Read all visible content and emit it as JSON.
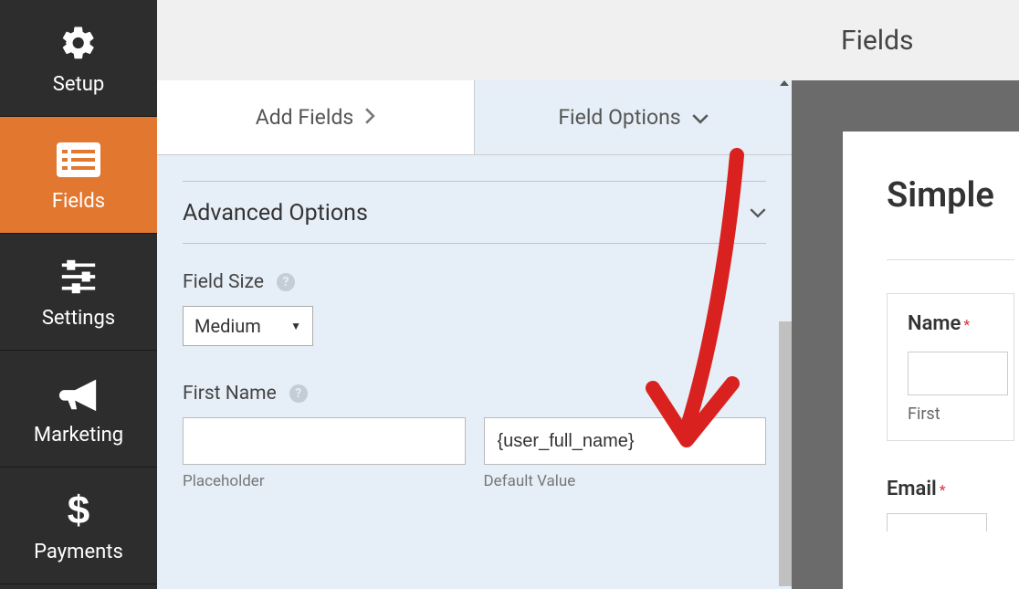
{
  "sidebar": {
    "items": [
      {
        "label": "Setup"
      },
      {
        "label": "Fields"
      },
      {
        "label": "Settings"
      },
      {
        "label": "Marketing"
      },
      {
        "label": "Payments"
      }
    ]
  },
  "tabs": {
    "add_fields": "Add Fields",
    "field_options": "Field Options"
  },
  "advanced": {
    "title": "Advanced Options",
    "field_size_label": "Field Size",
    "field_size_value": "Medium",
    "first_name_label": "First Name",
    "placeholder_label": "Placeholder",
    "default_value_label": "Default Value",
    "placeholder_value": "",
    "default_value": "{user_full_name}"
  },
  "right": {
    "header": "Fields",
    "form_title": "Simple",
    "name_label": "Name",
    "first_label": "First",
    "email_label": "Email"
  }
}
